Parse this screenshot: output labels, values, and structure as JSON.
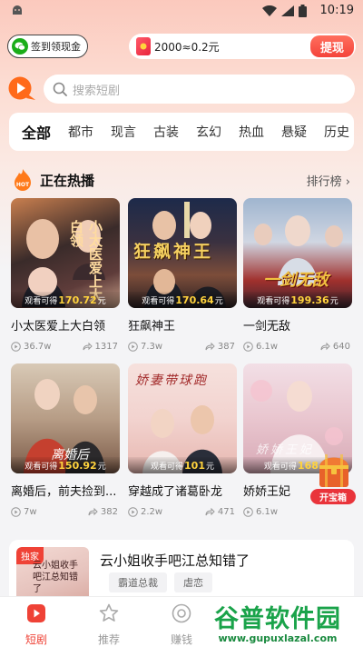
{
  "status_bar": {
    "time": "10:19"
  },
  "header": {
    "checkin_label": "签到领现金",
    "reward_amount": "2000≈0.2元",
    "withdraw_label": "提现"
  },
  "search": {
    "placeholder": "搜索短剧"
  },
  "categories": [
    {
      "label": "全部",
      "active": true
    },
    {
      "label": "都市"
    },
    {
      "label": "现言"
    },
    {
      "label": "古装"
    },
    {
      "label": "玄幻"
    },
    {
      "label": "热血"
    },
    {
      "label": "悬疑"
    },
    {
      "label": "历史"
    }
  ],
  "hot": {
    "title": "正在热播",
    "rank_label": "排行榜",
    "earn_prefix": "观看可得",
    "earn_suffix": "元",
    "dramas": [
      {
        "name": "小太医爱上大白领",
        "earn": "170.72",
        "views": "36.7w",
        "shares": "1317",
        "poster_text": "小太医爱上大白领"
      },
      {
        "name": "狂飙神王",
        "earn": "170.64",
        "views": "7.3w",
        "shares": "387",
        "poster_text": "狂飙神王"
      },
      {
        "name": "一剑无敌",
        "earn": "199.36",
        "views": "6.1w",
        "shares": "640",
        "poster_text": "一剑无敌"
      },
      {
        "name": "离婚后，前夫捡到...",
        "earn": "150.92",
        "views": "7w",
        "shares": "382",
        "poster_text": "离婚后"
      },
      {
        "name": "穿越成了诸葛卧龙",
        "earn": "101",
        "views": "2.2w",
        "shares": "471",
        "poster_text": "娇妻带球跑"
      },
      {
        "name": "娇娇王妃",
        "earn": "168.",
        "views": "6.1w",
        "shares": "",
        "poster_text": "娇娇王妃"
      }
    ],
    "treasure_label": "开宝箱"
  },
  "featured": {
    "badge": "独家",
    "thumb_text": "云小姐收手吧江总知错了",
    "title": "云小姐收手吧江总知错了",
    "tags": [
      "霸道总裁",
      "虐恋"
    ]
  },
  "bottom_nav": [
    {
      "label": "短剧",
      "active": true
    },
    {
      "label": "推荐"
    },
    {
      "label": "赚钱"
    }
  ],
  "watermark": {
    "title": "谷普软件园",
    "url": "www.gupuxlazal.com"
  },
  "colors": {
    "accent": "#ef4236",
    "brand_orange": "#ff6a1a",
    "earn_highlight": "#ffd33d"
  }
}
